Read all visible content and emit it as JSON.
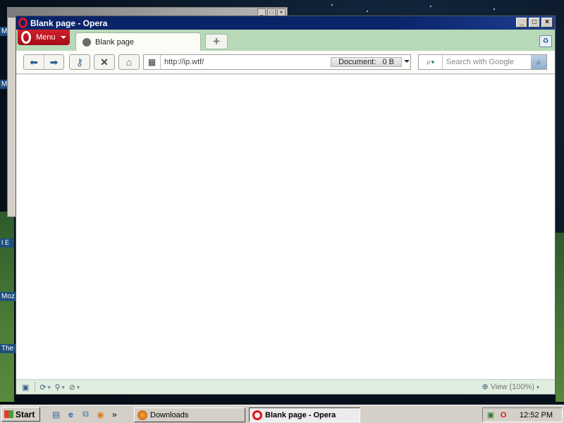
{
  "desktop": {
    "labels": [
      "M",
      "M",
      "I E",
      "Moz",
      "The"
    ]
  },
  "window": {
    "title": "Blank page - Opera",
    "minimize": "_",
    "maximize": "□",
    "close": "×"
  },
  "tabbar": {
    "menu_label": "Menu",
    "tabs": [
      {
        "label": "Blank page"
      }
    ],
    "new_tab_symbol": "+"
  },
  "toolbar": {
    "address_value": "http://ip.wtf/",
    "document_label": "Document:",
    "document_size": "0 B",
    "search_placeholder": "Search with Google"
  },
  "statusbar": {
    "view_label": "View (100%)"
  },
  "taskbar": {
    "start_label": "Start",
    "tasks": [
      {
        "label": "Downloads",
        "active": false
      },
      {
        "label": "Blank page - Opera",
        "active": true
      }
    ],
    "clock": "12:52 PM"
  },
  "colors": {
    "title_bar": "#0a246a",
    "opera_red": "#d3202a",
    "tab_strip": "#b7d9b7",
    "statusbar": "#dfeee0"
  },
  "icons": [
    "back-icon",
    "forward-icon",
    "key-icon",
    "stop-icon",
    "home-icon",
    "speed-dial-icon",
    "search-engine-icon",
    "search-go-icon",
    "trash-icon",
    "panel-toggle-icon",
    "turbo-icon",
    "unite-icon",
    "block-icon",
    "zoom-icon"
  ]
}
